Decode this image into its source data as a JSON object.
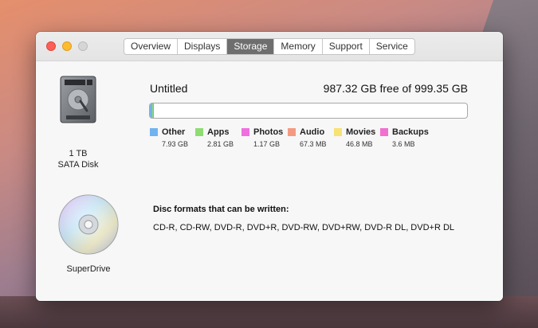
{
  "tabs": [
    {
      "label": "Overview",
      "active": false
    },
    {
      "label": "Displays",
      "active": false
    },
    {
      "label": "Storage",
      "active": true
    },
    {
      "label": "Memory",
      "active": false
    },
    {
      "label": "Support",
      "active": false
    },
    {
      "label": "Service",
      "active": false
    }
  ],
  "disk": {
    "capacity": "1 TB",
    "type": "SATA Disk",
    "volume_name": "Untitled",
    "free_text": "987.32 GB free of 999.35 GB"
  },
  "legend": [
    {
      "name": "Other",
      "size": "7.93 GB",
      "color": "#6fb3f0"
    },
    {
      "name": "Apps",
      "size": "2.81 GB",
      "color": "#8fdc73"
    },
    {
      "name": "Photos",
      "size": "1.17 GB",
      "color": "#ef6fe0"
    },
    {
      "name": "Audio",
      "size": "67.3 MB",
      "color": "#f59a82"
    },
    {
      "name": "Movies",
      "size": "46.8 MB",
      "color": "#f7e273"
    },
    {
      "name": "Backups",
      "size": "3.6 MB",
      "color": "#f06fd0"
    }
  ],
  "usage_fraction": {
    "other": 0.0079,
    "apps": 0.0028,
    "photos": 0.0012
  },
  "superdrive": {
    "label": "SuperDrive",
    "formats_title": "Disc formats that can be written:",
    "formats": "CD-R, CD-RW, DVD-R, DVD+R, DVD-RW, DVD+RW, DVD-R DL, DVD+R DL"
  }
}
